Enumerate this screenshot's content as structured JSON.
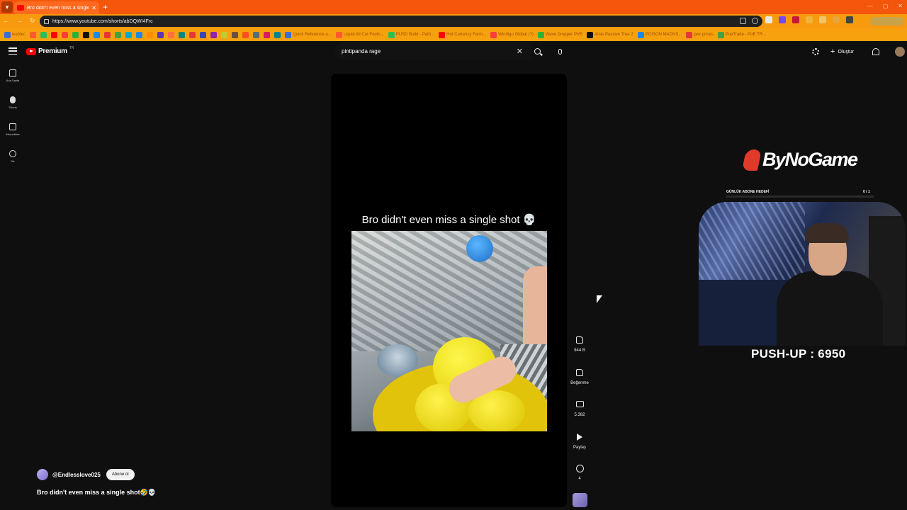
{
  "browser": {
    "tab_title": "Bro didn't even miss a single",
    "url": "https://www.youtube.com/shorts/abDQWI4Frc",
    "bookmarks": [
      "wabtec",
      "",
      "",
      "",
      "",
      "",
      "",
      "",
      "",
      "",
      "",
      "",
      "",
      "",
      "",
      "",
      "",
      "",
      "",
      "",
      "",
      "",
      "",
      "",
      "",
      "Quick Reference a...",
      "Liquid All Cut Footn...",
      "PUSD Build - Path...",
      "Hot Currency Farm...",
      "Windigo Global (?)",
      "Wave Dropper PVE",
      "Atlas Passive Tree 2",
      "POISON MADNS...",
      "pex prices",
      "PoeTrade - PoE TR..."
    ]
  },
  "youtube": {
    "logo_text": "Premium",
    "logo_region": "TR",
    "search": {
      "value": "pintipanda rage"
    },
    "create_label": "Oluştur",
    "sidebar": [
      {
        "label": "Ana Sayfa"
      },
      {
        "label": "Shorts"
      },
      {
        "label": "Abonelikler"
      },
      {
        "label": "Siz"
      }
    ]
  },
  "short": {
    "caption": "Bro didn't even miss a single shot 💀",
    "likes": "944 B",
    "dislike_label": "Beğenme",
    "comments": "5.382",
    "share_label": "Paylaş",
    "remix_count": "4",
    "channel": "@Endlesslove025",
    "subscribe_label": "Abone ol",
    "description": "Bro didn't even miss a single shot🤣💀"
  },
  "overlay": {
    "brand": "ByNoGame",
    "sub_goal_label": "GÜNLÜK ABONE HEDEFİ",
    "sub_goal_count": "0 / 1",
    "sub_goal_fraction": 0,
    "pushup": "PUSH-UP : 6950"
  },
  "colors": {
    "tab_bar": "#f4560c",
    "address_bar": "#f79a0e",
    "yt_bg": "#0f0f0f",
    "yt_red": "#ff0000",
    "bng_red": "#e23a2a"
  }
}
